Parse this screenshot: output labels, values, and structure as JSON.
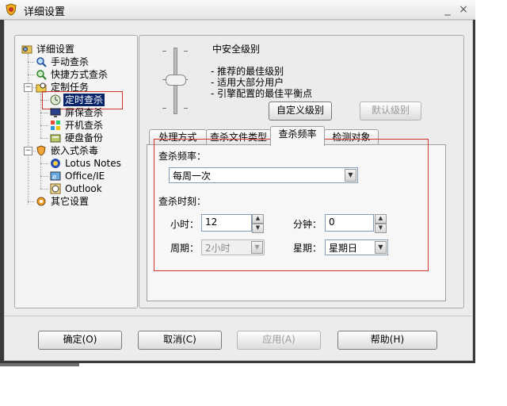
{
  "window": {
    "title": "详细设置",
    "minimize": "_",
    "close": "×"
  },
  "tree": {
    "root": "详细设置",
    "items": [
      {
        "label": "手动查杀"
      },
      {
        "label": "快捷方式查杀"
      },
      {
        "label": "定制任务"
      },
      {
        "label": "定时查杀"
      },
      {
        "label": "屏保查杀"
      },
      {
        "label": "开机查杀"
      },
      {
        "label": "硬盘备份"
      },
      {
        "label": "嵌入式杀毒"
      },
      {
        "label": "Lotus Notes"
      },
      {
        "label": "Office/IE"
      },
      {
        "label": "Outlook"
      },
      {
        "label": "其它设置"
      }
    ]
  },
  "security": {
    "level_title": "中安全级别",
    "bullets": [
      "- 推荐的最佳级别",
      "- 适用大部分用户",
      "- 引擎配置的最佳平衡点"
    ],
    "custom_button": "自定义级别",
    "default_button": "默认级别"
  },
  "tabs": [
    "处理方式",
    "查杀文件类型",
    "查杀频率",
    "检测对象"
  ],
  "panel": {
    "frequency_label": "查杀频率：",
    "frequency_value": "每周一次",
    "time_label": "查杀时刻：",
    "hour_label": "小时：",
    "hour_value": "12",
    "minute_label": "分钟：",
    "minute_value": "0",
    "period_label": "周期：",
    "period_value": "2小时",
    "weekday_label": "星期：",
    "weekday_value": "星期日"
  },
  "buttons": {
    "ok": "确定(O)",
    "cancel": "取消(C)",
    "apply": "应用(A)",
    "help": "帮助(H)"
  }
}
